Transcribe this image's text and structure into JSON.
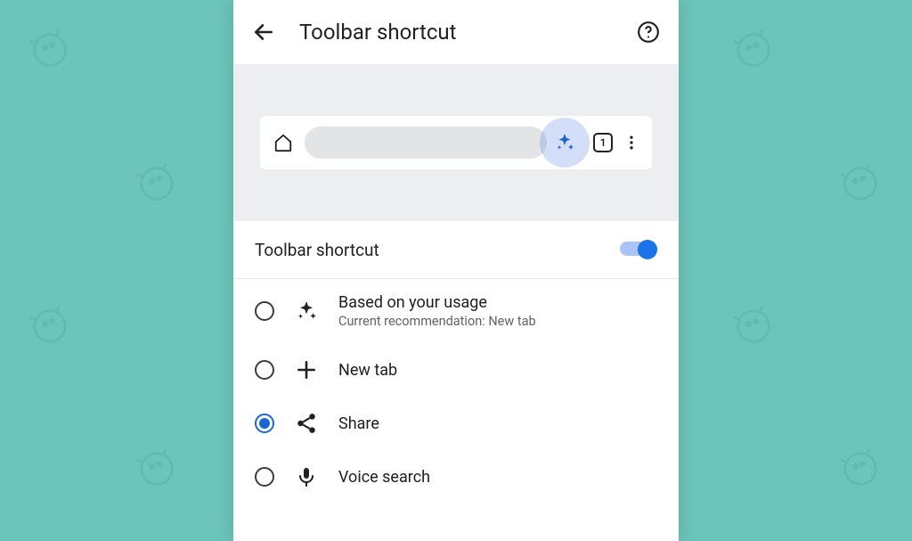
{
  "header": {
    "title": "Toolbar shortcut"
  },
  "preview": {
    "tab_count": "1"
  },
  "toggle": {
    "label": "Toolbar shortcut",
    "on": true
  },
  "options": [
    {
      "id": "usage",
      "title": "Based on your usage",
      "subtitle": "Current recommendation:  New tab",
      "selected": false,
      "icon": "sparkle"
    },
    {
      "id": "newtab",
      "title": "New tab",
      "selected": false,
      "icon": "plus"
    },
    {
      "id": "share",
      "title": "Share",
      "selected": true,
      "icon": "share"
    },
    {
      "id": "voice",
      "title": "Voice search",
      "selected": false,
      "icon": "mic"
    }
  ],
  "colors": {
    "accent": "#1a73e8",
    "background": "#6cc5b8"
  }
}
